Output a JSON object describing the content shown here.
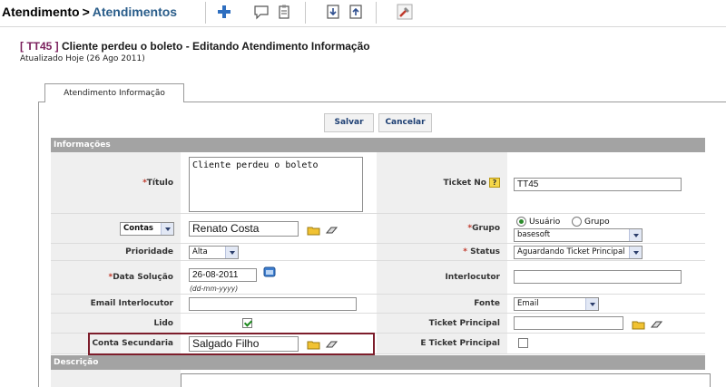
{
  "header": {
    "breadcrumb_root": "Atendimento",
    "breadcrumb_sep": ">",
    "breadcrumb_current": "Atendimentos"
  },
  "toolbar": {
    "icons": [
      "add-icon",
      "comment-icon",
      "clipboard-icon",
      "download-icon",
      "upload-icon",
      "tools-icon"
    ]
  },
  "record": {
    "code": "[ TT45 ]",
    "title": "Cliente perdeu o boleto - Editando Atendimento Informação",
    "updated": "Atualizado Hoje (26 Ago 2011)"
  },
  "tab": {
    "label": "Atendimento Informação"
  },
  "actions": {
    "save_label": "Salvar",
    "cancel_label": "Cancelar"
  },
  "sections": {
    "info": "Informações",
    "description": "Descrição"
  },
  "form": {
    "titulo_label": "Título",
    "titulo_value": "Cliente perdeu o boleto",
    "ticket_no_label": "Ticket No",
    "ticket_no_value": "TT45",
    "contas_select": "Contas",
    "conta_value": "Renato Costa",
    "grupo_label": "Grupo",
    "radio_usuario": "Usuário",
    "radio_grupo": "Grupo",
    "grupo_select": "basesoft",
    "prioridade_label": "Prioridade",
    "prioridade_value": "Alta",
    "status_label": "Status",
    "status_value": "Aguardando Ticket Principal",
    "data_solucao_label": "Data Solução",
    "data_solucao_value": "26-08-2011",
    "data_hint": "(dd-mm-yyyy)",
    "interlocutor_label": "Interlocutor",
    "interlocutor_value": "",
    "email_interlocutor_label": "Email Interlocutor",
    "email_interlocutor_value": "",
    "fonte_label": "Fonte",
    "fonte_value": "Email",
    "lido_label": "Lido",
    "ticket_principal_label": "Ticket Principal",
    "ticket_principal_value": "",
    "conta_secundaria_label": "Conta Secundaria",
    "conta_secundaria_value": "Salgado Filho",
    "e_ticket_principal_label": "E Ticket Principal",
    "required_mark": "*"
  },
  "colors": {
    "section_bg": "#a3a3a3",
    "label_bg": "#efefef",
    "highlight": "#7d1d2b",
    "link": "#2a5d8a",
    "record_code": "#7a1f5c"
  }
}
